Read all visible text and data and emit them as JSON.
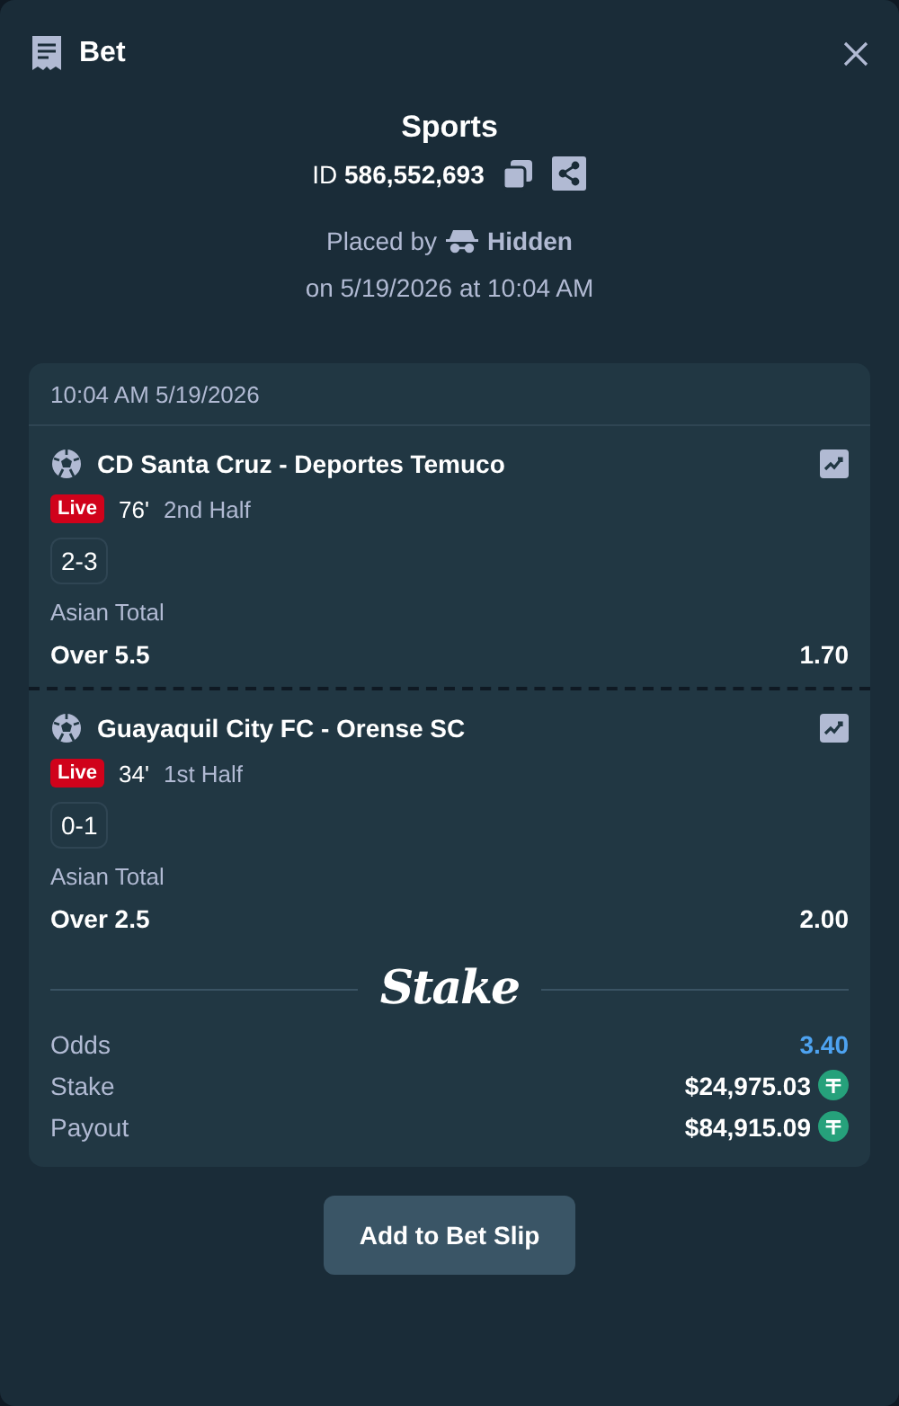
{
  "header": {
    "title": "Bet"
  },
  "summary": {
    "title": "Sports",
    "id_label": "ID",
    "id_value": "586,552,693",
    "placed_by_label": "Placed by",
    "placed_by_user": "Hidden",
    "placed_on": "on 5/19/2026 at 10:04 AM"
  },
  "slip": {
    "timestamp": "10:04 AM 5/19/2026",
    "legs": [
      {
        "match": "CD Santa Cruz - Deportes Temuco",
        "status": "Live",
        "minute": "76'",
        "period": "2nd Half",
        "score": "2-3",
        "market": "Asian Total",
        "outcome": "Over 5.5",
        "odds": "1.70"
      },
      {
        "match": "Guayaquil City FC - Orense SC",
        "status": "Live",
        "minute": "34'",
        "period": "1st Half",
        "score": "0-1",
        "market": "Asian Total",
        "outcome": "Over 2.5",
        "odds": "2.00"
      }
    ],
    "brand": "Stake",
    "totals": [
      {
        "kind": "odds",
        "label": "Odds",
        "value": "3.40"
      },
      {
        "kind": "amount",
        "label": "Stake",
        "value": "$24,975.03"
      },
      {
        "kind": "amount",
        "label": "Payout",
        "value": "$84,915.09"
      }
    ]
  },
  "actions": [
    "Add to Bet Slip"
  ]
}
